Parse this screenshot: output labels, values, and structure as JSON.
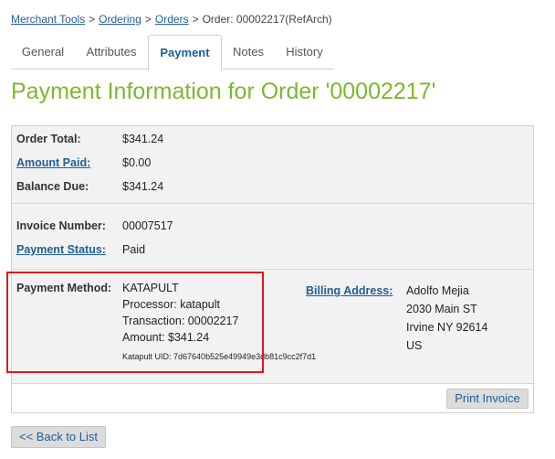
{
  "breadcrumb": {
    "items": [
      "Merchant Tools",
      "Ordering",
      "Orders"
    ],
    "separator": ">",
    "current": "Order: 00002217(RefArch)"
  },
  "tabs": [
    "General",
    "Attributes",
    "Payment",
    "Notes",
    "History"
  ],
  "active_tab": "Payment",
  "page": {
    "title": "Payment Information for Order '00002217'"
  },
  "summary": {
    "order_total_label": "Order Total:",
    "order_total": "$341.24",
    "amount_paid_label": "Amount Paid:",
    "amount_paid": "$0.00",
    "balance_due_label": "Balance Due:",
    "balance_due": "$341.24"
  },
  "invoice": {
    "number_label": "Invoice Number:",
    "number": "00007517",
    "status_label": "Payment Status:",
    "status": "Paid"
  },
  "payment": {
    "method_label": "Payment Method:",
    "method": "KATAPULT",
    "processor": "Processor: katapult",
    "transaction": "Transaction: 00002217",
    "amount": "Amount: $341.24",
    "uid": "Katapult UID: 7d67640b525e49949e3db81c9cc2f7d1"
  },
  "billing": {
    "label": "Billing Address:",
    "lines": [
      "Adolfo Mejia",
      "2030 Main ST",
      "Irvine NY 92614",
      "US"
    ]
  },
  "buttons": {
    "print_invoice": "Print Invoice",
    "back": "<< Back to List"
  },
  "colors": {
    "title_green": "#7cb82f",
    "link_blue": "#1f5d99",
    "highlight_red": "#e0141e"
  }
}
